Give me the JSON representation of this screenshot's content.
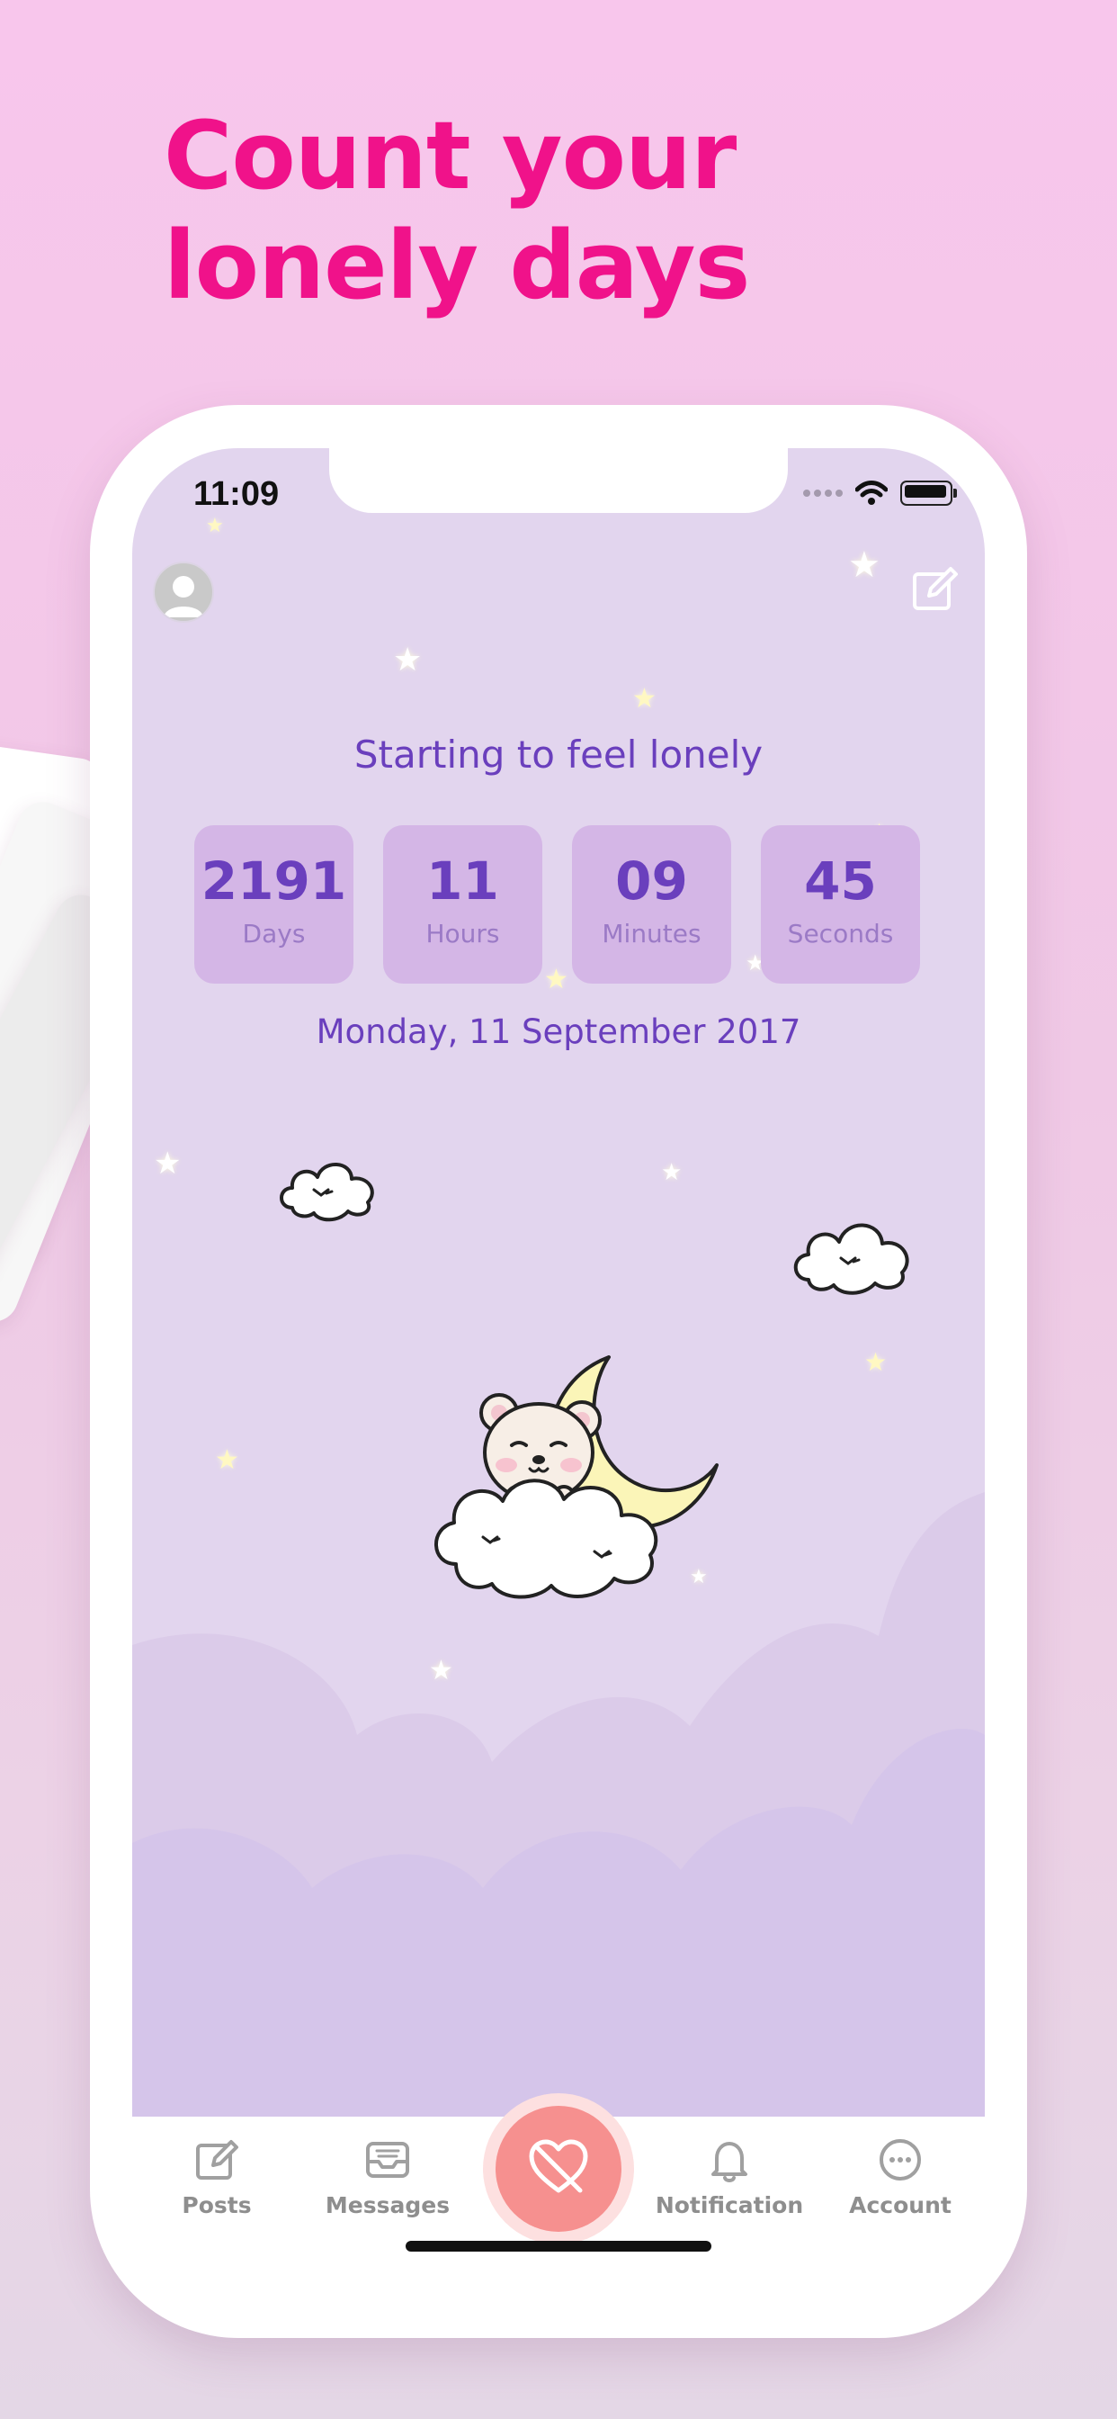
{
  "headline": "Count your lonely days",
  "status_bar": {
    "time": "11:09"
  },
  "header": {
    "avatar_icon": "user-avatar-icon",
    "edit_icon": "edit-icon"
  },
  "main": {
    "title": "Starting to feel lonely",
    "counters": [
      {
        "value": "2191",
        "unit": "Days"
      },
      {
        "value": "11",
        "unit": "Hours"
      },
      {
        "value": "09",
        "unit": "Minutes"
      },
      {
        "value": "45",
        "unit": "Seconds"
      }
    ],
    "date": "Monday, 11 September 2017",
    "illustration": "bear-sleeping-on-cloud-with-moon"
  },
  "tabbar": {
    "items": [
      {
        "label": "Posts",
        "icon": "posts-icon"
      },
      {
        "label": "Messages",
        "icon": "inbox-icon"
      },
      {
        "label": "",
        "icon": "heart-off-icon"
      },
      {
        "label": "Notification",
        "icon": "bell-icon"
      },
      {
        "label": "Account",
        "icon": "more-icon"
      }
    ]
  },
  "colors": {
    "headline": "#f0128a",
    "accent_purple": "#6a3fbd",
    "counter_bg": "#d4b6e6",
    "screen_bg": "#e2d5ee",
    "center_button": "#f6908f"
  }
}
